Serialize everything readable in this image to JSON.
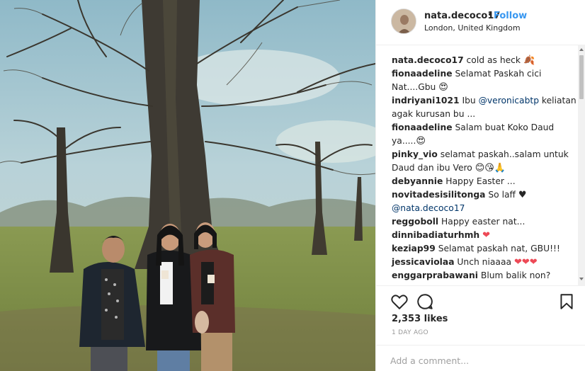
{
  "post": {
    "username": "nata.decoco17",
    "follow_label": "Follow",
    "separator": "•",
    "location": "London, United Kingdom"
  },
  "comments": [
    {
      "user": "nata.decoco17",
      "lines": [
        {
          "text": " cold as heck ",
          "emoji": "🍂"
        }
      ]
    },
    {
      "user": "fionaadeline",
      "lines": [
        {
          "text": " Selamat Paskah cici"
        },
        {
          "text": "Nat....Gbu ",
          "emoji": "😍"
        }
      ]
    },
    {
      "user": "indriyani1021",
      "lines": [
        {
          "text": " Ibu ",
          "mention": "@veronicabtp",
          "after": " keliatan"
        },
        {
          "text": "agak kurusan bu ..."
        }
      ]
    },
    {
      "user": "fionaadeline",
      "lines": [
        {
          "text": " Salam buat Koko Daud"
        },
        {
          "text": "ya.....",
          "emoji": "😍"
        }
      ]
    },
    {
      "user": "pinky_vio",
      "lines": [
        {
          "text": " selamat paskah..salam untuk"
        },
        {
          "text": "Daud dan ibu Vero ",
          "emoji": "😊😘🙏"
        }
      ]
    },
    {
      "user": "debyannie",
      "lines": [
        {
          "text": " Happy Easter ..."
        }
      ]
    },
    {
      "user": "novitadesisilitonga",
      "lines": [
        {
          "text": " So laff ",
          "emoji": "♥"
        },
        {
          "text": "",
          "mention": "@nata.decoco17",
          "after": ""
        }
      ]
    },
    {
      "user": "reggoboll",
      "lines": [
        {
          "text": " Happy easter nat..."
        }
      ]
    },
    {
      "user": "dinnibadiaturhmh",
      "lines": [
        {
          "text": " ",
          "emoji": "❤"
        }
      ]
    },
    {
      "user": "keziap99",
      "lines": [
        {
          "text": " Selamat paskah nat, GBU!!!"
        }
      ]
    },
    {
      "user": "jessicaviolaa",
      "lines": [
        {
          "text": " Unch niaaaa ",
          "emoji": "❤❤❤"
        }
      ]
    },
    {
      "user": "enggarprabawani",
      "lines": [
        {
          "text": " Blum balik non?"
        }
      ]
    }
  ],
  "likes": "2,353 likes",
  "timestamp": "1 DAY AGO",
  "add_comment_placeholder": "Add a comment...",
  "icons": {
    "like": "heart-outline-icon",
    "comment": "speech-bubble-icon",
    "save": "bookmark-icon"
  },
  "colors": {
    "link": "#3897f0",
    "mention": "#003569",
    "heart": "#ed4956",
    "muted": "#999999"
  }
}
